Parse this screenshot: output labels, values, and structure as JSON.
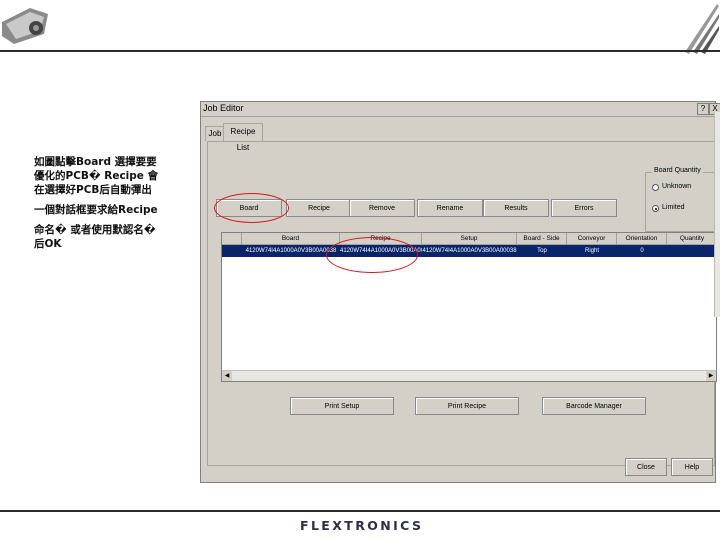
{
  "annotation": {
    "lines": [
      "如圖點擊Board 選擇要要",
      "優化的PCB� Recipe 會",
      "在選擇好PCB后自動彈出",
      "一個對話框要求給Recipe",
      "命名� 或者使用默認名�",
      "后OK"
    ]
  },
  "dialog": {
    "title": "Job Editor",
    "help_btn": "?",
    "close_btn": "X",
    "tabs": [
      "Job",
      "Recipe List"
    ],
    "group_title": "Board Quantity",
    "radios": [
      {
        "label": "Unknown",
        "selected": false
      },
      {
        "label": "Limited",
        "selected": true
      }
    ],
    "buttons": [
      "Board",
      "Recipe",
      "Remove",
      "Rename",
      "Results",
      "Errors"
    ],
    "table": {
      "headers": [
        "Board",
        "Recipe",
        "Setup",
        "Board - Side",
        "Conveyor",
        "Orientation",
        "Quantity"
      ],
      "rows": [
        [
          "4120W74I4A1000A0V3B00A0038",
          "4120W74I4A1000A0V3B00A00038",
          "4120W74I4A1000A0V3B00A00038",
          "Top",
          "Right",
          "0",
          ""
        ]
      ]
    },
    "bottom_buttons": [
      "Print Setup",
      "Print Recipe",
      "Barcode Manager"
    ],
    "footer_buttons": [
      "Close",
      "Help"
    ]
  },
  "footer": {
    "brand": "FLEXTRONICS"
  },
  "colors": {
    "selection": "#0a246a",
    "highlight_circle": "#d11a1a"
  }
}
